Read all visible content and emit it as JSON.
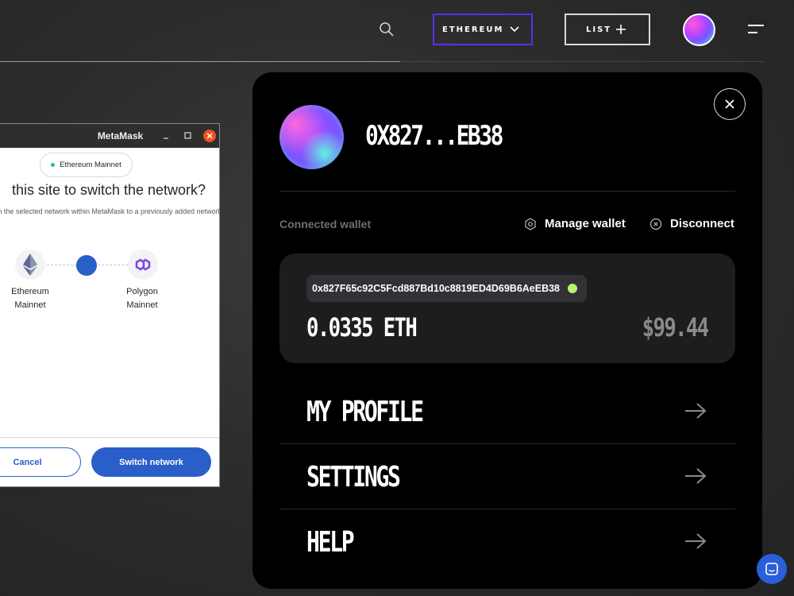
{
  "header": {
    "network_label": "ETHEREUM",
    "list_label": "LIST"
  },
  "wallet_panel": {
    "short_address": "0X827...EB38",
    "connected_label": "Connected wallet",
    "manage_label": "Manage wallet",
    "disconnect_label": "Disconnect",
    "full_address": "0x827F65c92C5Fcd887Bd10c8819ED4D69B6AeEB38",
    "eth_balance": "0.0335 ETH",
    "usd_balance": "$99.44",
    "menu": [
      {
        "label": "MY PROFILE"
      },
      {
        "label": "SETTINGS"
      },
      {
        "label": "HELP"
      }
    ]
  },
  "metamask": {
    "title": "MetaMask",
    "network_pill": "Ethereum Mainnet",
    "heading": "this site to switch the network?",
    "description": "n the selected network within MetaMask to a previously added network:",
    "from_network": "Ethereum Mainnet",
    "to_network": "Polygon Mainnet",
    "cancel_label": "Cancel",
    "switch_label": "Switch network"
  },
  "colors": {
    "accent_purple": "#5b2ef0",
    "metamask_blue": "#2a5ec8",
    "status_green": "#b9f46a",
    "chat_blue": "#2b5fd9"
  }
}
